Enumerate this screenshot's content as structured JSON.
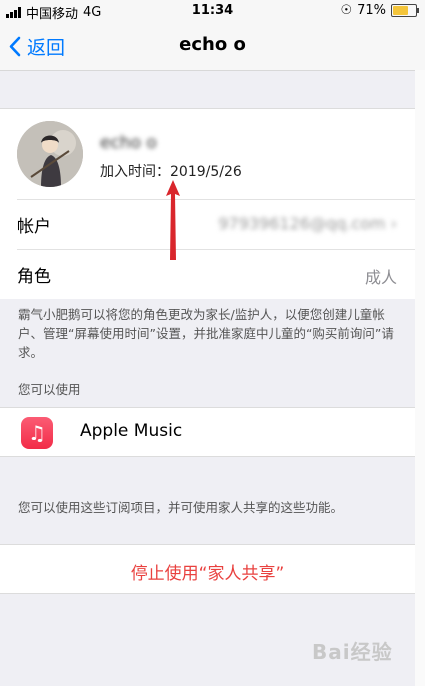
{
  "status_bar": {
    "carrier": "中国移动",
    "network": "4G",
    "time": "11:34",
    "battery": "71%"
  },
  "nav": {
    "back_label": "返回",
    "title": "echo o"
  },
  "profile": {
    "name": "echo o",
    "join_date": "加入时间：2019/5/26"
  },
  "rows": {
    "account_label": "帐户",
    "account_value": "979396126@qq.com",
    "role_label": "角色",
    "role_value": "成人"
  },
  "notes": {
    "role_note": "霸气小肥鹅可以将您的角色更改为家长/监护人，以便您创建儿童帐户、管理“屏幕使用时间”设置，并批准家庭中儿童的“购买前询问”请求。",
    "can_use_header": "您可以使用",
    "subscriptions_note": "您可以使用这些订阅项目，并可使用家人共享的这些功能。"
  },
  "services": [
    {
      "label": "Apple Music",
      "icon": "music-note-icon"
    }
  ],
  "stop_sharing": "停止使用“家人共享”",
  "watermark": "Bai经验",
  "colors": {
    "accent": "#007aff",
    "danger": "#e9413f",
    "annotation": "#d9262c"
  }
}
